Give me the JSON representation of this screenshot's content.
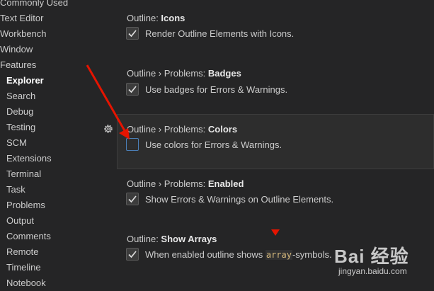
{
  "sidebar": {
    "items": [
      {
        "label": "Commonly Used",
        "level": "top"
      },
      {
        "label": "Text Editor",
        "level": "top"
      },
      {
        "label": "Workbench",
        "level": "top"
      },
      {
        "label": "Window",
        "level": "top"
      },
      {
        "label": "Features",
        "level": "top"
      },
      {
        "label": "Explorer",
        "level": "sub",
        "active": true
      },
      {
        "label": "Search",
        "level": "sub"
      },
      {
        "label": "Debug",
        "level": "sub"
      },
      {
        "label": "Testing",
        "level": "sub"
      },
      {
        "label": "SCM",
        "level": "sub"
      },
      {
        "label": "Extensions",
        "level": "sub"
      },
      {
        "label": "Terminal",
        "level": "sub"
      },
      {
        "label": "Task",
        "level": "sub"
      },
      {
        "label": "Problems",
        "level": "sub"
      },
      {
        "label": "Output",
        "level": "sub"
      },
      {
        "label": "Comments",
        "level": "sub"
      },
      {
        "label": "Remote",
        "level": "sub"
      },
      {
        "label": "Timeline",
        "level": "sub"
      },
      {
        "label": "Notebook",
        "level": "sub"
      }
    ]
  },
  "settings": {
    "icons": {
      "prefix": "Outline: ",
      "name": "Icons",
      "description": "Render Outline Elements with Icons.",
      "checked": true
    },
    "badges": {
      "prefix": "Outline › Problems: ",
      "name": "Badges",
      "description": "Use badges for Errors & Warnings.",
      "checked": true
    },
    "colors": {
      "prefix": "Outline › Problems: ",
      "name": "Colors",
      "description": "Use colors for Errors & Warnings.",
      "checked": false
    },
    "enabled": {
      "prefix": "Outline › Problems: ",
      "name": "Enabled",
      "description": "Show Errors & Warnings on Outline Elements.",
      "checked": true
    },
    "arrays": {
      "prefix": "Outline: ",
      "name": "Show Arrays",
      "description_before": "When enabled outline shows ",
      "description_code": "array",
      "description_after": "-symbols.",
      "checked": true
    }
  },
  "icons": {
    "gear": "gear-icon",
    "checkmark": "checkmark-icon",
    "annotation": "red-arrow-icon"
  },
  "colors": {
    "background": "#252526",
    "focused_row": "#2d2d2d",
    "annotation_red": "#e51400"
  },
  "watermark": {
    "brand": "Bai 经验",
    "url": "jingyan.baidu.com"
  }
}
